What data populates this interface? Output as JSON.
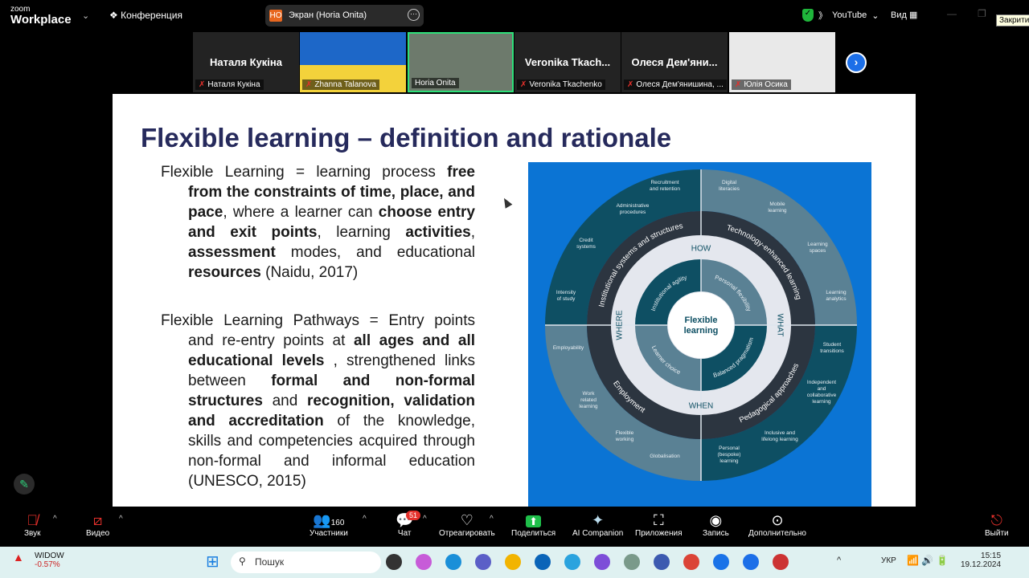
{
  "app": {
    "logo_small": "zoom",
    "logo_big": "Workplace",
    "meeting_label": "Конференция",
    "share_initials": "НО",
    "share_title": "Экран (Horia Onita)",
    "stream": "YouTube",
    "view": "Вид",
    "close_tooltip": "Закрити"
  },
  "participants": [
    {
      "big": "Наталя Кукіна",
      "label": "Наталя Кукіна",
      "muted": true
    },
    {
      "big": "",
      "label": "Zhanna Talanova",
      "muted": true
    },
    {
      "big": "",
      "label": "Horia Onita",
      "muted": false,
      "active": true
    },
    {
      "big": "Veronika  Tkach...",
      "label": "Veronika Tkachenko",
      "muted": true
    },
    {
      "big": "Олеся  Дем'яни...",
      "label": "Олеся Дем'янишина, ...",
      "muted": true
    },
    {
      "big": "",
      "label": "Юлія Осика",
      "muted": true
    }
  ],
  "slide": {
    "title": "Flexible learning – definition and rationale",
    "para1": [
      [
        "Flexible Learning =  learning process ",
        0
      ],
      [
        "free from the constraints of time, place, and pace",
        1
      ],
      [
        ", where a learner can ",
        0
      ],
      [
        "choose entry and exit points",
        1
      ],
      [
        ", learning ",
        0
      ],
      [
        "activities",
        1
      ],
      [
        ", ",
        0
      ],
      [
        "assessment",
        1
      ],
      [
        " modes, and educational ",
        0
      ],
      [
        "resources",
        1
      ],
      [
        " (Naidu, 2017)",
        0
      ]
    ],
    "para2": [
      [
        "Flexible Learning Pathways = Entry points and re-entry points at ",
        0
      ],
      [
        "all ages and all educational levels",
        1
      ],
      [
        " , strengthened links between ",
        0
      ],
      [
        "formal and non-formal structures",
        1
      ],
      [
        " and ",
        0
      ],
      [
        "recognition, validation and accreditation",
        1
      ],
      [
        " of the knowledge, skills and competencies acquired through non-formal and informal education (UNESCO, 2015)",
        0
      ]
    ]
  },
  "diagram": {
    "center": [
      "Flexible",
      "learning"
    ],
    "compass": {
      "top": "HOW",
      "right": "WHAT",
      "bottom": "WHEN",
      "left": "WHERE"
    },
    "ring_dark": {
      "tl": "Institutional systems and structures",
      "tr": "Technology-enhanced learning",
      "br": "Pedagogical approaches",
      "bl": "Employment"
    },
    "ring_inner": {
      "tl": "Institutional agility",
      "tr": "Personal flexibility",
      "br": "Balanced pragmatism",
      "bl": "Learner choice"
    },
    "outer": [
      "Recruitment|and retention",
      "Administrative|procedures",
      "Credit|systems",
      "Intensity|of study",
      "Digital|literacies",
      "Mobile|learning",
      "Learning|spaces",
      "Learning|analytics",
      "Student|transitions",
      "Independent|and|collaborative|learning",
      "Inclusive and|lifelong learning",
      "Personal|(bespoke)|learning",
      "Globalisation",
      "Flexible|working",
      "Work|related|learning",
      "Employability"
    ],
    "colors": {
      "bg": "#0b74d4",
      "dark_teal": "#0e4f63",
      "grey_blue": "#5a8194",
      "ring": "#2c3540",
      "light": "#e4e7ee"
    }
  },
  "toolbar": {
    "audio": "Звук",
    "video": "Видео",
    "participants": "Участники",
    "participants_count": "160",
    "chat": "Чат",
    "chat_badge": "51",
    "react": "Отреагировать",
    "share": "Поделиться",
    "ai": "AI Companion",
    "apps": "Приложения",
    "record": "Запись",
    "more": "Дополнительно",
    "leave": "Выйти"
  },
  "taskbar": {
    "stock_name": "WIDOW",
    "stock_change": "-0.57%",
    "search": "Пошук",
    "lang": "УКР",
    "time": "15:15",
    "date": "19.12.2024"
  }
}
